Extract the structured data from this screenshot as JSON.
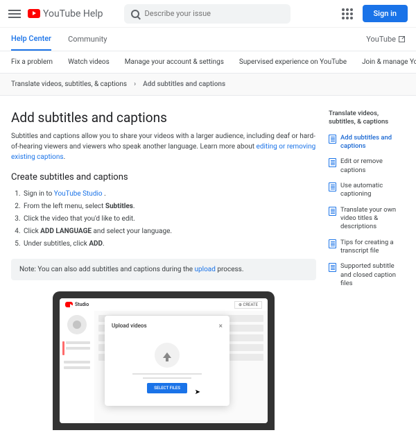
{
  "header": {
    "logo": "YouTube Help",
    "search_placeholder": "Describe your issue",
    "signin": "Sign in"
  },
  "tabs": {
    "help_center": "Help Center",
    "community": "Community",
    "youtube": "YouTube"
  },
  "subnav": {
    "fix": "Fix a problem",
    "watch": "Watch videos",
    "manage": "Manage your account & settings",
    "supervised": "Supervised experience on YouTube",
    "premium": "Join & manage YouTube Premium"
  },
  "breadcrumb": {
    "parent": "Translate videos, subtitles, & captions",
    "current": "Add subtitles and captions"
  },
  "article": {
    "title": "Add subtitles and captions",
    "intro_a": "Subtitles and captions allow you to share your videos with a larger audience, including deaf or hard-of-hearing viewers and viewers who speak another language. Learn more about ",
    "intro_link": "editing or removing existing captions",
    "h2": "Create subtitles and captions",
    "step1a": "Sign in to ",
    "step1_link": "YouTube Studio",
    "step1b": " .",
    "step2a": "From the left menu, select ",
    "step2b": "Subtitles",
    "step3": "Click the video that you'd like to edit.",
    "step4a": "Click ",
    "step4b": "ADD LANGUAGE",
    "step4c": " and select your language.",
    "step5a": "Under subtitles, click ",
    "step5b": "ADD",
    "note_a": "Note: You can also add subtitles and captions during the ",
    "note_link": "upload",
    "note_b": " process."
  },
  "preview": {
    "studio": "Studio",
    "create": "⊕ CREATE",
    "modal_title": "Upload videos",
    "select": "SELECT FILES"
  },
  "sidebar": {
    "title": "Translate videos, subtitles, & captions",
    "items": [
      "Add subtitles and captions",
      "Edit or remove captions",
      "Use automatic captioning",
      "Translate your own video titles & descriptions",
      "Tips for creating a transcript file",
      "Supported subtitle and closed caption files"
    ]
  }
}
